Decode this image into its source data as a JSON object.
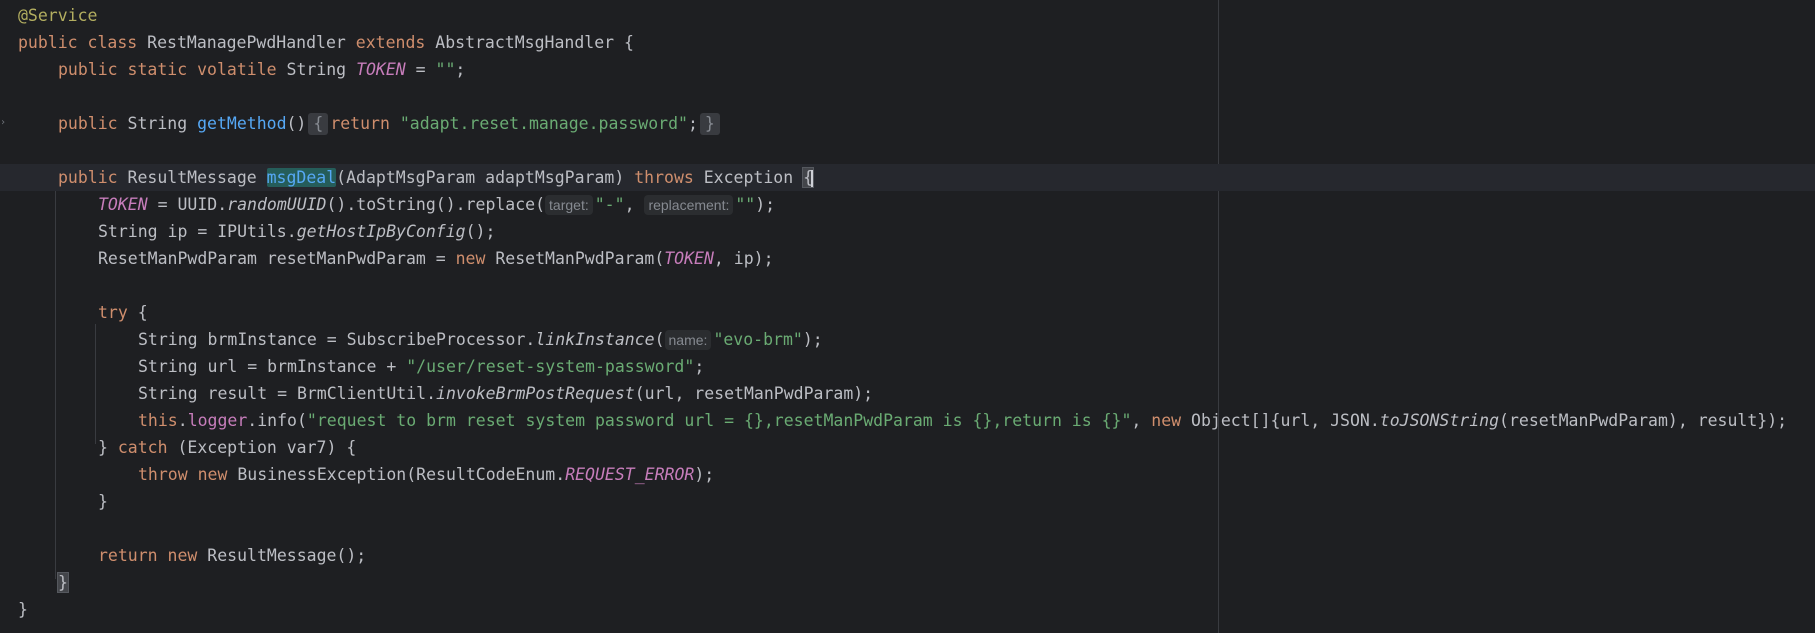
{
  "editor": {
    "lines": {
      "l1": {
        "ann": "@Service"
      },
      "l2": {
        "kw1": "public",
        "kw2": "class",
        "name": "RestManagePwdHandler",
        "kw3": "extends",
        "parent": "AbstractMsgHandler",
        "brace": "{"
      },
      "l3": {
        "kw1": "public",
        "kw2": "static",
        "kw3": "volatile",
        "type": "String",
        "const": "TOKEN",
        "eq": "=",
        "val": "\"\"",
        "semi": ";"
      },
      "l5": {
        "kw1": "public",
        "type": "String",
        "fn": "getMethod",
        "paren": "()",
        "fold_open": "{",
        "kw_ret": "return",
        "val": "\"adapt.reset.manage.password\"",
        "semi": ";",
        "fold_close": "}"
      },
      "l7": {
        "kw1": "public",
        "type": "ResultMessage",
        "fn": "msgDeal",
        "params": "(AdaptMsgParam adaptMsgParam)",
        "kw_throws": "throws",
        "exc": "Exception",
        "brace": "{"
      },
      "l8": {
        "const": "TOKEN",
        "mid": " = UUID.",
        "m1": "randomUUID",
        "mid2": "().toString().replace(",
        "hint1": "target:",
        "s1": "\"-\"",
        "comma": ", ",
        "hint2": "replacement:",
        "s2": "\"\"",
        "end": ");"
      },
      "l9": {
        "pre": "String ip = IPUtils.",
        "m1": "getHostIpByConfig",
        "end": "();"
      },
      "l10": {
        "pre": "ResetManPwdParam resetManPwdParam = ",
        "kw": "new",
        "mid": " ResetManPwdParam(",
        "const": "TOKEN",
        "end": ", ip);"
      },
      "l12": {
        "kw": "try",
        "brace": " {"
      },
      "l13": {
        "pre": "String brmInstance = SubscribeProcessor.",
        "m1": "linkInstance",
        "open": "(",
        "hint": "name:",
        "s1": "\"evo-brm\"",
        "end": ");"
      },
      "l14": {
        "pre": "String url = brmInstance + ",
        "s1": "\"/user/reset-system-password\"",
        "end": ";"
      },
      "l15": {
        "pre": "String result = BrmClientUtil.",
        "m1": "invokeBrmPostRequest",
        "end": "(url, resetManPwdParam);"
      },
      "l16": {
        "kw_this": "this",
        "dot": ".",
        "field": "logger",
        "mid": ".info(",
        "s1": "\"request to brm reset system password url = {},resetManPwdParam is {},return is {}\"",
        "comma": ", ",
        "kw_new": "new",
        "mid2": " Object[]{url, JSON.",
        "m1": "toJSONString",
        "end": "(resetManPwdParam), result});"
      },
      "l17": {
        "pre": "} ",
        "kw": "catch",
        "end": " (Exception var7) {"
      },
      "l18": {
        "kw1": "throw",
        "kw2": "new",
        "mid": " BusinessException(ResultCodeEnum.",
        "const": "REQUEST_ERROR",
        "end": ");"
      },
      "l19": {
        "brace": "}"
      },
      "l21": {
        "kw1": "return",
        "kw2": "new",
        "end": " ResultMessage();"
      },
      "l22": {
        "brace": "}"
      },
      "l23": {
        "brace": "}"
      }
    }
  },
  "colors": {
    "background": "#1e1f22",
    "keyword": "#cf8e6d",
    "string": "#6aab73",
    "annotation": "#b3ae60",
    "function": "#56a8f5",
    "constant": "#c77dbb",
    "default_text": "#bcbec4"
  },
  "icons": {
    "gutter": "fold-arrow-icon"
  }
}
